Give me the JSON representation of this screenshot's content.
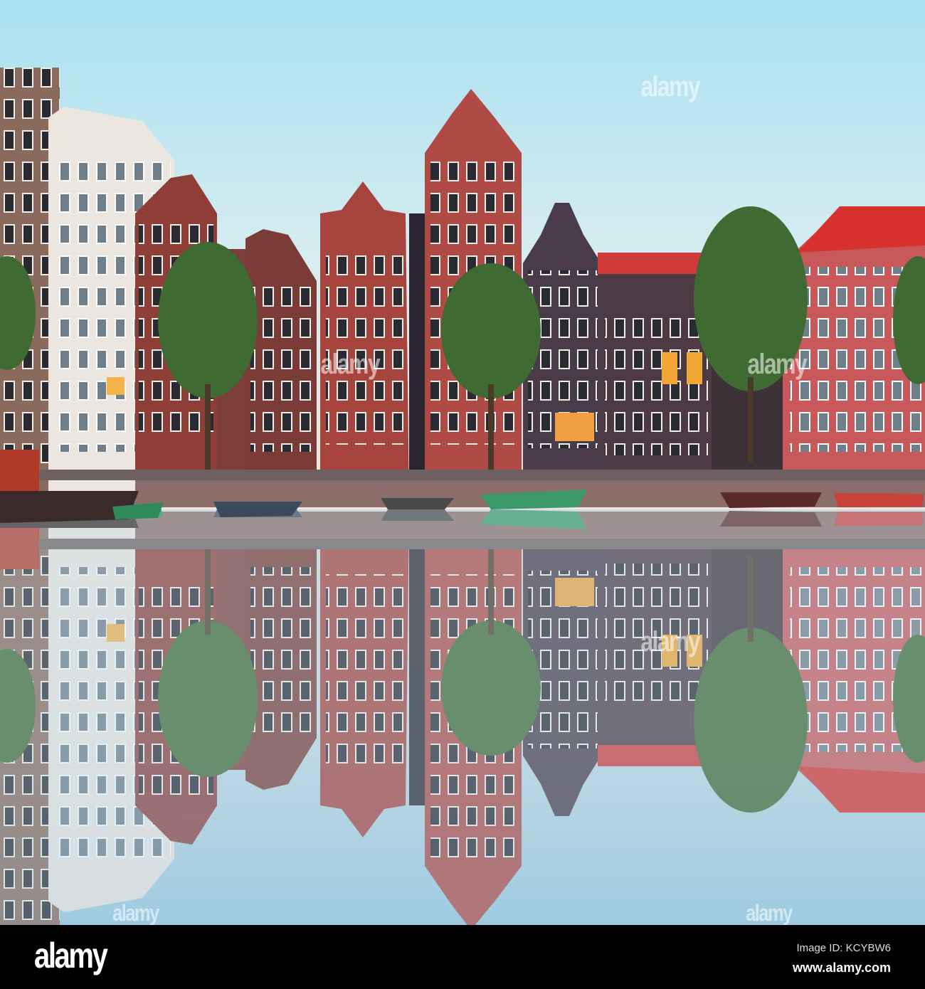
{
  "photo": {
    "subject": "Amsterdam canal houses reflected in water",
    "colors": {
      "sky_top": "#a8e0f2",
      "sky_bottom": "#e9ecea",
      "water": "#a8c6d8"
    }
  },
  "watermark": "alamy",
  "footer": {
    "logo": "alamy",
    "image_id": "Image ID: KCYBW6",
    "website": "www.alamy.com"
  }
}
